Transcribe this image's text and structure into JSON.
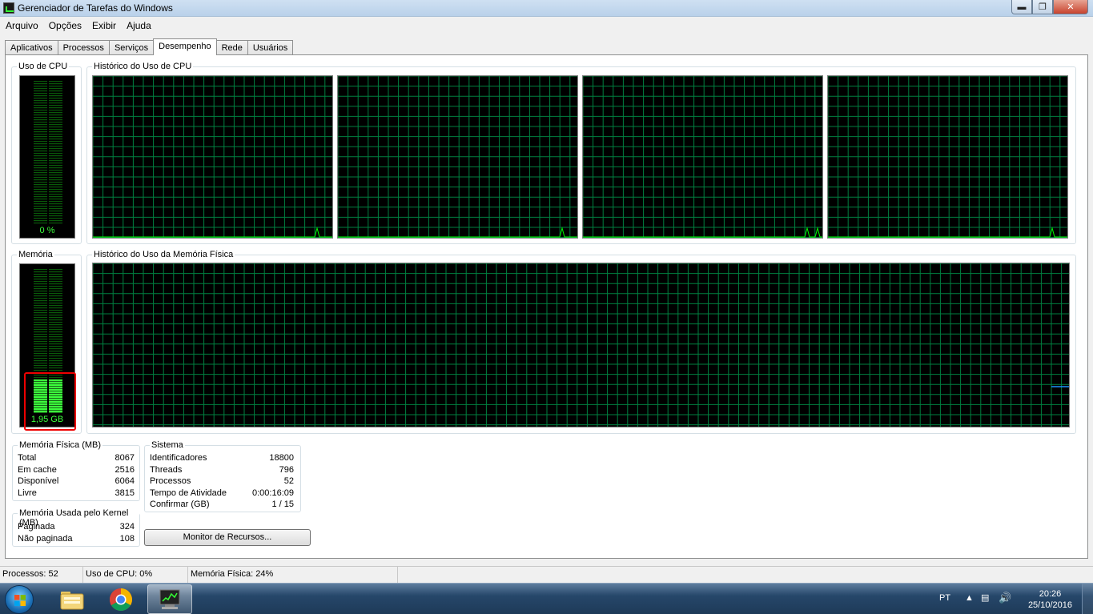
{
  "window": {
    "title": "Gerenciador de Tarefas do Windows"
  },
  "menu": [
    "Arquivo",
    "Opções",
    "Exibir",
    "Ajuda"
  ],
  "tabs": [
    {
      "label": "Aplicativos",
      "active": false
    },
    {
      "label": "Processos",
      "active": false
    },
    {
      "label": "Serviços",
      "active": false
    },
    {
      "label": "Desempenho",
      "active": true
    },
    {
      "label": "Rede",
      "active": false
    },
    {
      "label": "Usuários",
      "active": false
    }
  ],
  "cpu": {
    "label": "Uso de CPU",
    "value": "0 %",
    "level": 0.0
  },
  "cpu_history": {
    "label": "Histórico do Uso de CPU"
  },
  "memory": {
    "label": "Memória",
    "value": "1,95 GB",
    "level": 0.24
  },
  "memory_history": {
    "label": "Histórico do Uso da Memória Física"
  },
  "physical_memory": {
    "label": "Memória Física (MB)",
    "rows": [
      {
        "name": "Total",
        "value": "8067"
      },
      {
        "name": "Em cache",
        "value": "2516"
      },
      {
        "name": "Disponível",
        "value": "6064"
      },
      {
        "name": "Livre",
        "value": "3815"
      }
    ]
  },
  "kernel_memory": {
    "label": "Memória Usada pelo Kernel (MB)",
    "rows": [
      {
        "name": "Paginada",
        "value": "324"
      },
      {
        "name": "Não paginada",
        "value": "108"
      }
    ]
  },
  "system": {
    "label": "Sistema",
    "rows": [
      {
        "name": "Identificadores",
        "value": "18800"
      },
      {
        "name": "Threads",
        "value": "796"
      },
      {
        "name": "Processos",
        "value": "52"
      },
      {
        "name": "Tempo de Atividade",
        "value": "0:00:16:09"
      },
      {
        "name": "Confirmar (GB)",
        "value": "1 / 15"
      }
    ]
  },
  "resource_monitor_button": "Monitor de Recursos...",
  "statusbar": {
    "processes": "Processos: 52",
    "cpu": "Uso de CPU: 0%",
    "memory": "Memória Física: 24%"
  },
  "taskbar": {
    "language": "PT",
    "time": "20:26",
    "date": "25/10/2016"
  },
  "colors": {
    "graph_grid": "#008040",
    "graph_line": "#00ff00",
    "meter_on": "#3cff3c",
    "meter_off": "#0a5a0a",
    "highlight": "#ee0000"
  }
}
